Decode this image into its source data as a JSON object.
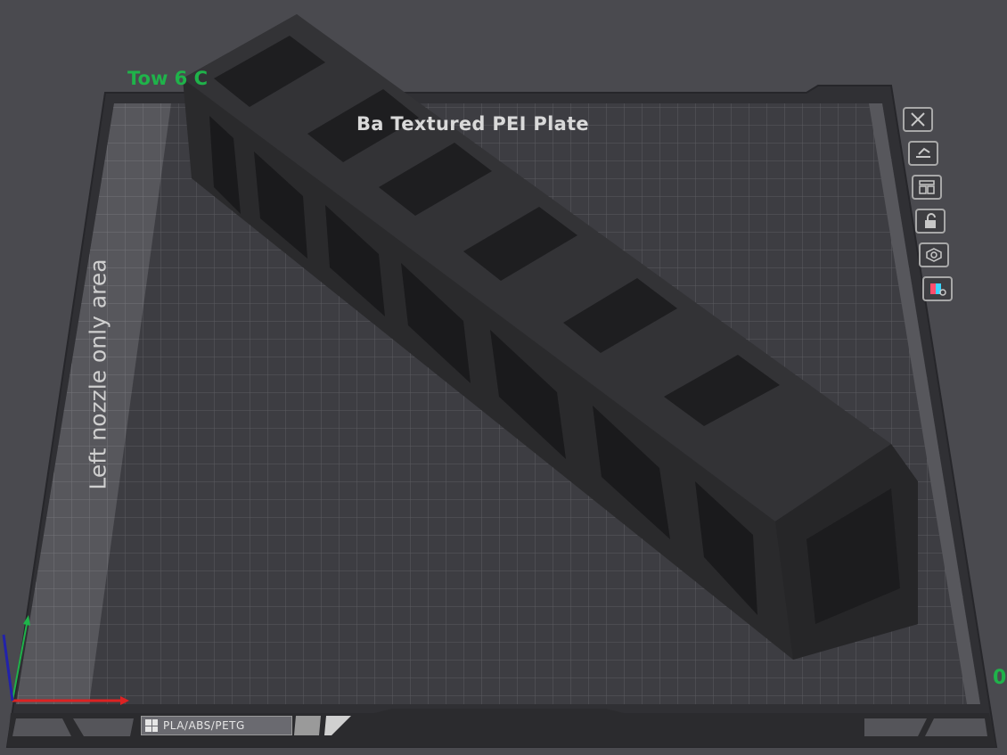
{
  "plate": {
    "name": "Tow    6 C",
    "type_label": "Ba      Textured PEI Plate",
    "nozzle_area_label": "Left nozzle only area",
    "filament_tag": "PLA/ABS/PETG",
    "edge_label": "0"
  },
  "toolbar": {
    "items": [
      {
        "name": "close-icon"
      },
      {
        "name": "auto-orient-icon"
      },
      {
        "name": "arrange-icon"
      },
      {
        "name": "lock-icon"
      },
      {
        "name": "plate-settings-icon"
      },
      {
        "name": "filament-map-icon"
      }
    ]
  },
  "colors": {
    "background": "#4a4a4f",
    "plate": "#3b3b3f",
    "grid": "#5d5d62",
    "accent_green": "#1fb34a",
    "model": "#2a2a2c"
  }
}
